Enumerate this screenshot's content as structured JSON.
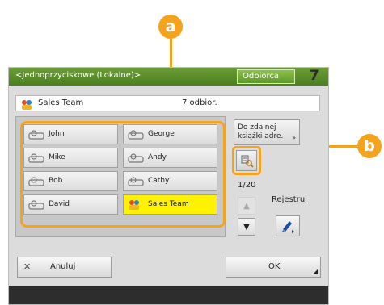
{
  "header": {
    "title": "<Jednoprzyciskowe (Lokalne)>",
    "tab_label": "Odbiorca",
    "count": "7"
  },
  "destination": {
    "name": "Sales Team",
    "count": "7 odbior."
  },
  "entries": [
    {
      "label": "John",
      "icon": "person-icon"
    },
    {
      "label": "George",
      "icon": "person-icon"
    },
    {
      "label": "Mike",
      "icon": "person-icon"
    },
    {
      "label": "Andy",
      "icon": "person-icon"
    },
    {
      "label": "Bob",
      "icon": "person-icon"
    },
    {
      "label": "Cathy",
      "icon": "person-icon"
    },
    {
      "label": "David",
      "icon": "person-icon"
    },
    {
      "label": "Sales Team",
      "icon": "group-icon",
      "selected": true
    }
  ],
  "side": {
    "remote_button": "Do zdalnej książki adre.",
    "page_indicator": "1/20",
    "register_label": "Rejestruj"
  },
  "footer": {
    "cancel_label": "Anuluj",
    "ok_label": "OK"
  },
  "callouts": {
    "a": "a",
    "b": "b"
  },
  "colors": {
    "accent": "#f5a21c",
    "title_green": "#5a8d2a",
    "selected": "#fff200"
  }
}
